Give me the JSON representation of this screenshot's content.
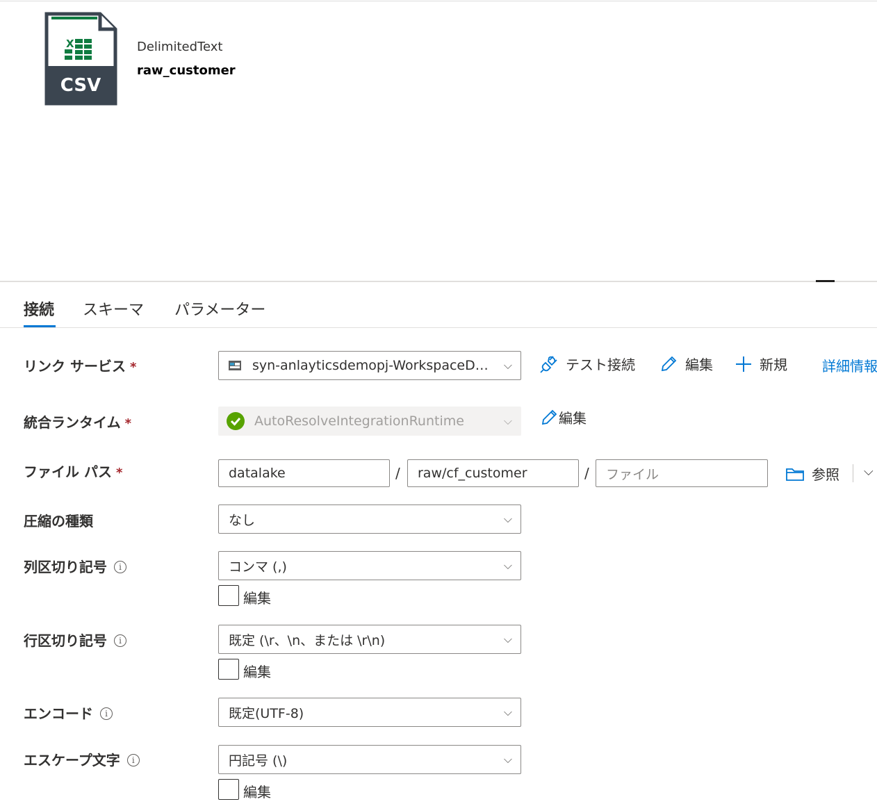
{
  "dataset": {
    "icon": "csv-file-icon",
    "icon_text": "CSV",
    "type": "DelimitedText",
    "name": "raw_customer"
  },
  "tabs": [
    {
      "label": "接続",
      "active": true
    },
    {
      "label": "スキーマ",
      "active": false
    },
    {
      "label": "パラメーター",
      "active": false
    }
  ],
  "linked_service": {
    "label": "リンク サービス",
    "required": "*",
    "value": "syn-anlayticsdemopj-WorkspaceDef...",
    "icon": "storage-icon",
    "test_connection": "テスト接続",
    "edit": "編集",
    "new": "新規",
    "details": "詳細情報"
  },
  "integration_runtime": {
    "label": "統合ランタイム",
    "required": "*",
    "value": "AutoResolveIntegrationRuntime",
    "status_color": "#57a300",
    "edit": "編集"
  },
  "file_path": {
    "label": "ファイル パス",
    "required": "*",
    "container": "datalake",
    "directory": "raw/cf_customer",
    "file_placeholder": "ファイル",
    "separator": "/",
    "browse": "参照"
  },
  "compression": {
    "label": "圧縮の種類",
    "value": "なし"
  },
  "column_delimiter": {
    "label": "列区切り記号",
    "value": "コンマ (,)",
    "edit": "編集"
  },
  "row_delimiter": {
    "label": "行区切り記号",
    "value": "既定 (\\r、\\n、または \\r\\n)",
    "edit": "編集"
  },
  "encoding": {
    "label": "エンコード",
    "value": "既定(UTF-8)"
  },
  "escape_char": {
    "label": "エスケープ文字",
    "value": "円記号 (\\)",
    "edit": "編集"
  },
  "colors": {
    "accent": "#0078d4",
    "required": "#a4262c",
    "excel_green": "#107c41"
  }
}
